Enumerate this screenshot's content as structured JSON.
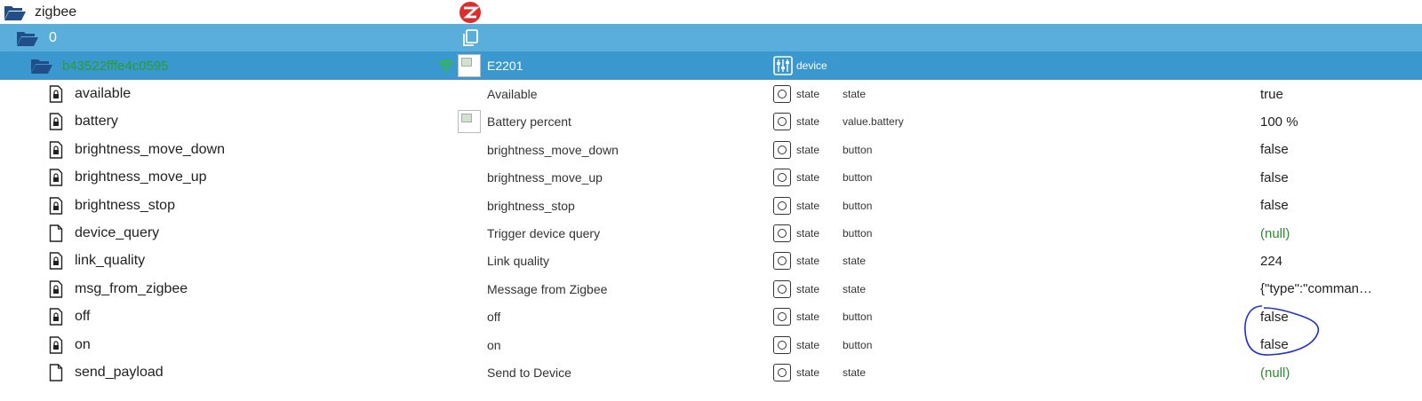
{
  "tree": {
    "root": {
      "label": "zigbee"
    },
    "instance": {
      "label": "0"
    },
    "device": {
      "id": "b43522fffe4c0595",
      "name": "E2201",
      "role": "device"
    }
  },
  "icons": {
    "folder": "folder-open-icon",
    "zigbee": "zigbee-logo-icon",
    "copy": "copy-icon",
    "wifi": "wifi-signal-icon",
    "device_settings": "sliders-icon",
    "state_lock": "lock-file-icon",
    "state_file": "file-icon",
    "state_button": "state-button-icon"
  },
  "colors": {
    "instance_bg": "#5aaedb",
    "device_bg": "#3a98cf",
    "device_id": "#2e9b2e",
    "null_value": "#2e8b2e",
    "annotation": "#1f2fd6"
  },
  "states": [
    {
      "name": "available",
      "desc": "Available",
      "role": "state",
      "type": "state",
      "value": "true",
      "icon": "lock"
    },
    {
      "name": "battery",
      "desc": "Battery percent",
      "role": "state",
      "type": "value.battery",
      "value": "100 %",
      "icon": "lock"
    },
    {
      "name": "brightness_move_down",
      "desc": "brightness_move_down",
      "role": "state",
      "type": "button",
      "value": "false",
      "icon": "lock"
    },
    {
      "name": "brightness_move_up",
      "desc": "brightness_move_up",
      "role": "state",
      "type": "button",
      "value": "false",
      "icon": "lock"
    },
    {
      "name": "brightness_stop",
      "desc": "brightness_stop",
      "role": "state",
      "type": "button",
      "value": "false",
      "icon": "lock"
    },
    {
      "name": "device_query",
      "desc": "Trigger device query",
      "role": "state",
      "type": "button",
      "value": "(null)",
      "icon": "file"
    },
    {
      "name": "link_quality",
      "desc": "Link quality",
      "role": "state",
      "type": "state",
      "value": "224",
      "icon": "lock"
    },
    {
      "name": "msg_from_zigbee",
      "desc": "Message from Zigbee",
      "role": "state",
      "type": "state",
      "value": "{\"type\":\"comman…",
      "icon": "lock"
    },
    {
      "name": "off",
      "desc": "off",
      "role": "state",
      "type": "button",
      "value": "false",
      "icon": "lock"
    },
    {
      "name": "on",
      "desc": "on",
      "role": "state",
      "type": "button",
      "value": "false",
      "icon": "lock"
    },
    {
      "name": "send_payload",
      "desc": "Send to Device",
      "role": "state",
      "type": "state",
      "value": "(null)",
      "icon": "file"
    }
  ]
}
